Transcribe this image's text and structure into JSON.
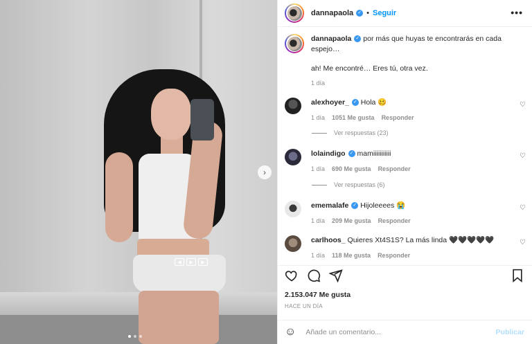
{
  "post": {
    "username": "dannapaola",
    "follow_label": "Seguir",
    "dot": "•",
    "more_label": "•••",
    "caption_line1": "por más que huyas te encontrarás en cada espejo…",
    "caption_line2": "ah! Me encontré… Eres tú, otra vez.",
    "caption_time": "1 día",
    "likes": "2.153.047 Me gusta",
    "time_ago": "HACE UN DÍA",
    "add_comment_placeholder": "Añade un comentario...",
    "publish_label": "Publicar"
  },
  "comments": [
    {
      "username": "alexhoyer_",
      "verified": true,
      "text": "Hola 🥴",
      "time": "1 día",
      "likes": "1051 Me gusta",
      "reply": "Responder",
      "replies": "Ver respuestas (23)"
    },
    {
      "username": "lolaindigo",
      "verified": true,
      "text": "mamiiiiiiiiiii",
      "time": "1 día",
      "likes": "690 Me gusta",
      "reply": "Responder",
      "replies": "Ver respuestas (6)"
    },
    {
      "username": "ememalafe",
      "verified": true,
      "text": "Hijoleeees 😭",
      "time": "1 día",
      "likes": "209 Me gusta",
      "reply": "Responder"
    },
    {
      "username": "carlhoos_",
      "verified": false,
      "text": "Quieres Xt4S1S? La más linda 🖤🖤🖤🖤🖤",
      "time": "1 día",
      "likes": "118 Me gusta",
      "reply": "Responder"
    }
  ],
  "media": {
    "next_arrow": "›",
    "controls": [
      "◀",
      "▶",
      "▶"
    ]
  },
  "colors": {
    "accent": "#0095f6",
    "verified": "#3897f0",
    "muted": "#8e8e8e"
  },
  "icons": [
    "heart-icon",
    "comment-icon",
    "share-icon",
    "bookmark-icon",
    "emoji-icon",
    "verified-badge-icon",
    "more-icon"
  ]
}
